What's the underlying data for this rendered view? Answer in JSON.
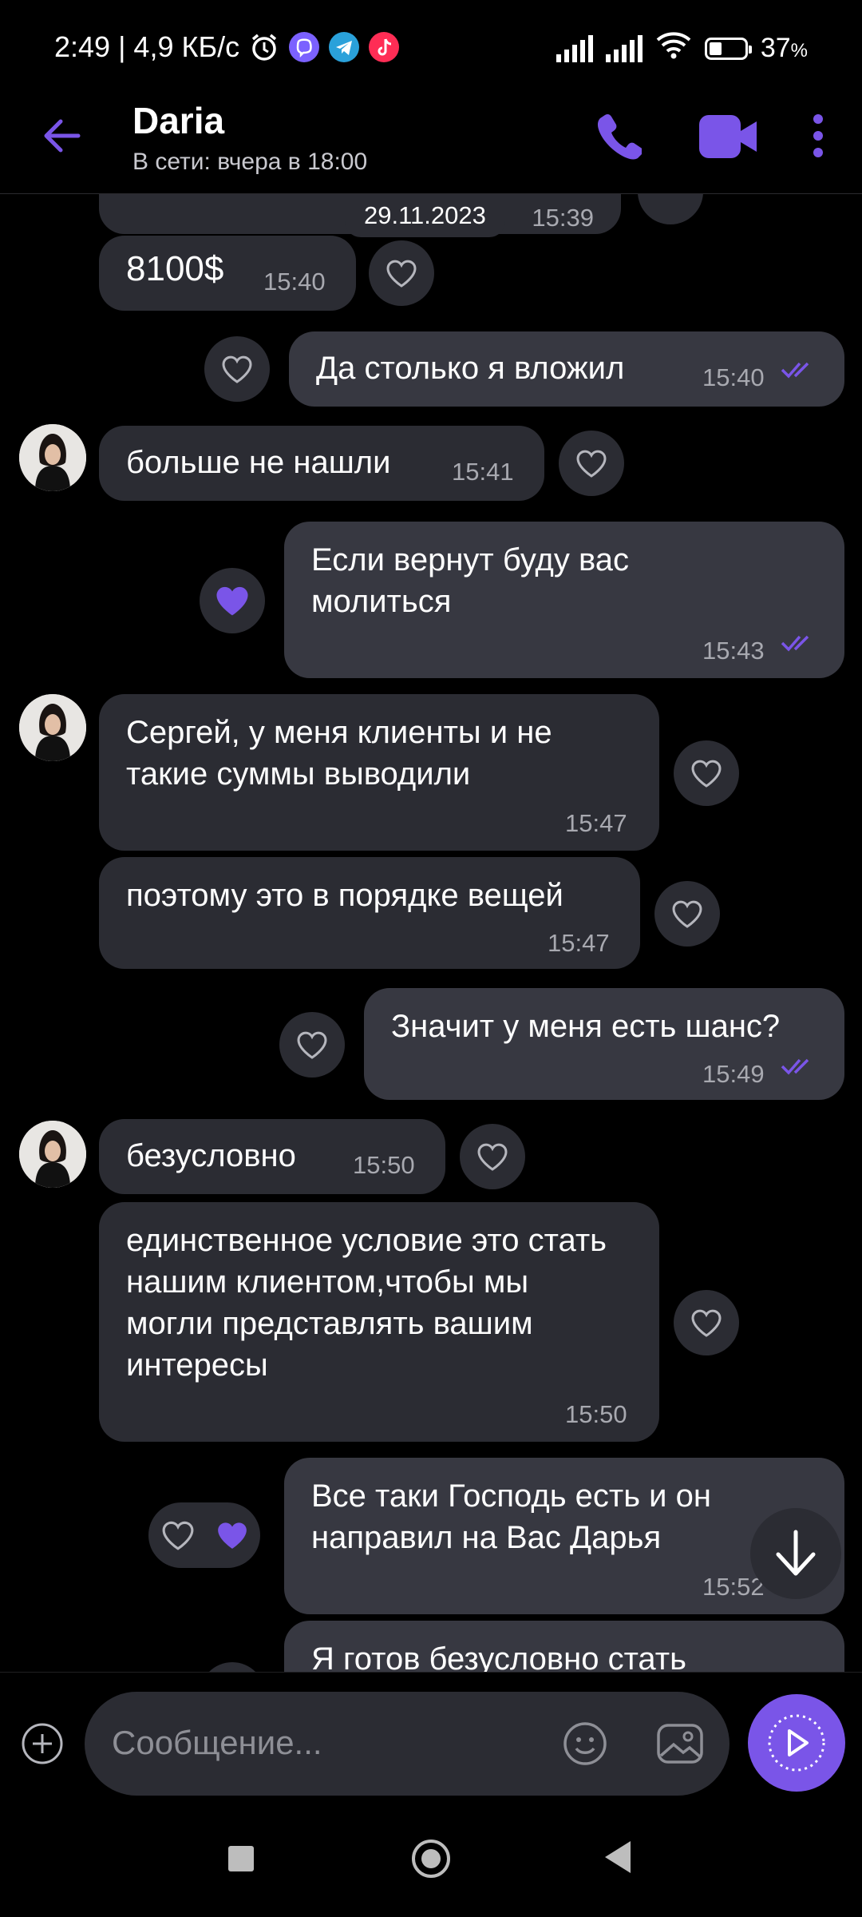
{
  "status_bar": {
    "time_speed": "2:49 | 4,9 КБ/с",
    "battery": "37",
    "battery_unit": "%",
    "battery_level": 0.37,
    "icons": [
      "alarm-icon",
      "viber-icon",
      "telegram-icon",
      "tiktok-icon",
      "signal-icon",
      "signal-icon",
      "wifi-icon",
      "battery-icon"
    ]
  },
  "header": {
    "name": "Daria",
    "status": "В сети: вчера в 18:00",
    "accent": "#7a55e8"
  },
  "chat": {
    "date_chip": "29.11.2023",
    "partial_time": "15:39",
    "messages": [
      {
        "dir": "in",
        "text": "8100$",
        "time": "15:40",
        "liked": false
      },
      {
        "dir": "out",
        "text": "Да столько я вложил",
        "time": "15:40",
        "liked": false
      },
      {
        "dir": "in",
        "text": "больше не нашли",
        "time": "15:41",
        "liked": false
      },
      {
        "dir": "out",
        "text": "Если вернут буду вас молиться",
        "time": "15:43",
        "liked": true
      },
      {
        "dir": "in",
        "text": "Сергей, у меня клиенты и не такие суммы выводили",
        "time": "15:47",
        "liked": false
      },
      {
        "dir": "in",
        "text": "поэтому это в порядке вещей",
        "time": "15:47",
        "liked": false
      },
      {
        "dir": "out",
        "text": "Значит у меня есть шанс?",
        "time": "15:49",
        "liked": false
      },
      {
        "dir": "in",
        "text": "безусловно",
        "time": "15:50",
        "liked": false
      },
      {
        "dir": "in",
        "text": "единственное условие это стать нашим клиентом,чтобы мы могли представлять вашим интересы",
        "time": "15:50",
        "liked": false
      },
      {
        "dir": "out",
        "text": "Все таки Господь есть и он направил на Вас Дарья",
        "time": "15:52",
        "liked": true
      },
      {
        "dir": "out",
        "text": "Я готов безусловно стать",
        "time": "",
        "liked": false
      }
    ]
  },
  "input": {
    "placeholder": "Сообщение..."
  }
}
